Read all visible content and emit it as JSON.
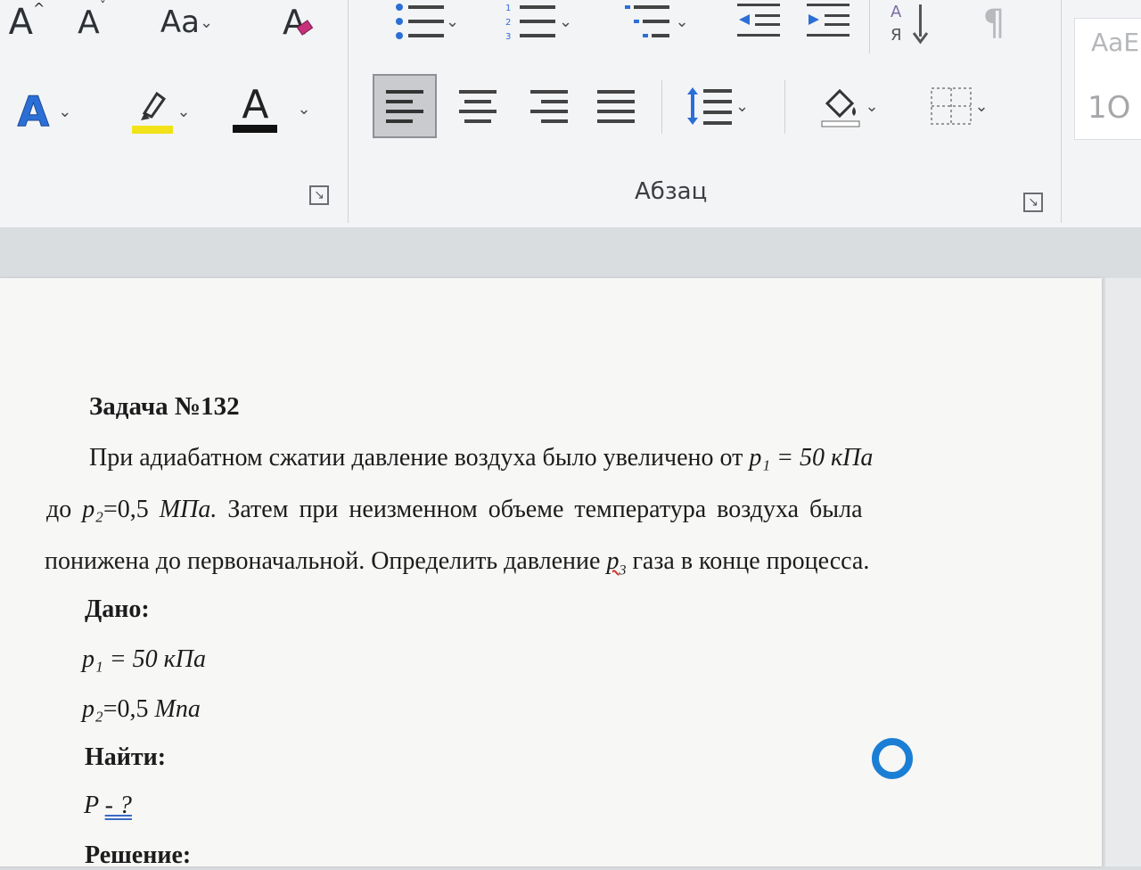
{
  "ribbon": {
    "font_grow": "A",
    "font_shrink": "A",
    "change_case": "Aa",
    "clear_format": "A",
    "sort": "А\nЯ",
    "pilcrow": "¶",
    "text_effects": "A",
    "font_color": "A",
    "paragraph_label": "Абзац",
    "styles_preview_1": "AaE",
    "styles_preview_2": "1О",
    "colors": {
      "highlight": "#f2e21a",
      "font_color_bar": "#111111",
      "effects": "#2b6fd6"
    }
  },
  "document": {
    "title": "Задача №132",
    "p1_a": "При адиабатном сжатии давление воздуха было увеличено от ",
    "p1_var": "p₁ = 50 кПа",
    "p2_a": "до ",
    "p2_var": "p₂",
    "p2_b": "=0,5  ",
    "p2_unit": "МПа.",
    "p2_c": " Затем при неизменном объеме температура воздуха была",
    "p3_a": "понижена до первоначальной. Определить давление ",
    "p3_var": "p",
    "p3_sub": "3",
    "p3_b": " газа в конце процесса.",
    "given_label": "Дано:",
    "given_1": "p₁ = 50 кПа",
    "given_2_var": "p₂",
    "given_2_b": "=0,5  ",
    "given_2_unit": "Мпа",
    "find_label": "Найти:",
    "find_1_var": "P ",
    "find_1_q": "- ?",
    "solution_label": "Решение:"
  }
}
